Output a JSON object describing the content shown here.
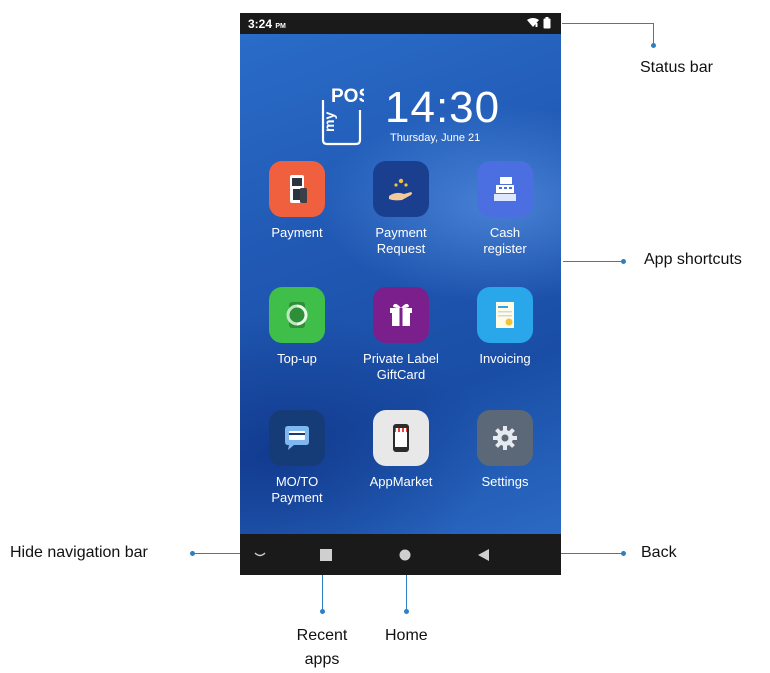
{
  "status_bar": {
    "time": "3:24",
    "ampm": "PM",
    "icons": [
      "wifi-icon",
      "battery-icon"
    ]
  },
  "home": {
    "logo_text": "POS",
    "logo_prefix": "my",
    "clock_time": "14:30",
    "clock_date": "Thursday, June 21"
  },
  "apps": [
    {
      "line1": "Payment",
      "line2": "",
      "icon": "payment-terminal-icon",
      "color": "#f0603f"
    },
    {
      "line1": "Payment",
      "line2": "Request",
      "icon": "hand-coins-icon",
      "color": "#1b3f8f"
    },
    {
      "line1": "Cash",
      "line2": "register",
      "icon": "cash-register-icon",
      "color": "#4b6fe0"
    },
    {
      "line1": "Top-up",
      "line2": "",
      "icon": "phone-topup-icon",
      "color": "#3fbf4a"
    },
    {
      "line1": "Private Label",
      "line2": "GiftCard",
      "icon": "gift-icon",
      "color": "#7a1f8c"
    },
    {
      "line1": "Invoicing",
      "line2": "",
      "icon": "invoice-icon",
      "color": "#29a7ea"
    },
    {
      "line1": "MO/TO",
      "line2": "Payment",
      "icon": "chat-card-icon",
      "color": "#163c78"
    },
    {
      "line1": "AppMarket",
      "line2": "",
      "icon": "store-phone-icon",
      "color": "#e8e8e8"
    },
    {
      "line1": "Settings",
      "line2": "",
      "icon": "gear-icon",
      "color": "#5b6878"
    }
  ],
  "navigation": {
    "buttons": [
      "hide-nav-icon",
      "recent-apps-icon",
      "home-icon",
      "back-icon"
    ]
  },
  "callouts": {
    "status_bar": "Status bar",
    "app_shortcuts": "App shortcuts",
    "hide_navigation_bar": "Hide navigation bar",
    "back": "Back",
    "recent_line1": "Recent",
    "recent_line2": "apps",
    "home": "Home"
  },
  "colors": {
    "accent": "#2f7fc1",
    "screen_blue": "#1f5fb8",
    "bars": "#1a1a1a"
  }
}
